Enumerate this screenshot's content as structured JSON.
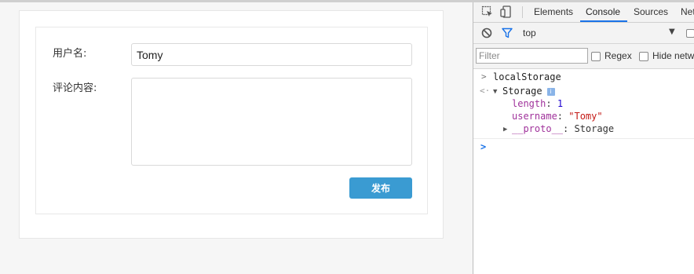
{
  "form": {
    "username_label": "用户名:",
    "username_value": "Tomy",
    "comment_label": "评论内容:",
    "comment_value": "",
    "publish_label": "发布"
  },
  "devtools": {
    "tabs": {
      "elements": "Elements",
      "console": "Console",
      "sources": "Sources",
      "network": "Net"
    },
    "active_tab": "Console",
    "context": "top",
    "filter_placeholder": "Filter",
    "regex_label": "Regex",
    "hide_label": "Hide netw",
    "console": {
      "input": "localStorage",
      "result_type": "Storage",
      "info_badge": "i",
      "props": {
        "length_key": "length",
        "length_value": "1",
        "username_key": "username",
        "username_value": "\"Tomy\"",
        "proto_key": "__proto__",
        "proto_value": "Storage"
      },
      "input_marker": ">",
      "output_marker": "<·",
      "prompt": ">"
    }
  },
  "colors": {
    "publish_button": "#3a9bd2",
    "active_tab_accent": "#1a73e8",
    "console_key": "#a0329b",
    "console_number": "#1c00cf",
    "console_string": "#c41a16"
  }
}
